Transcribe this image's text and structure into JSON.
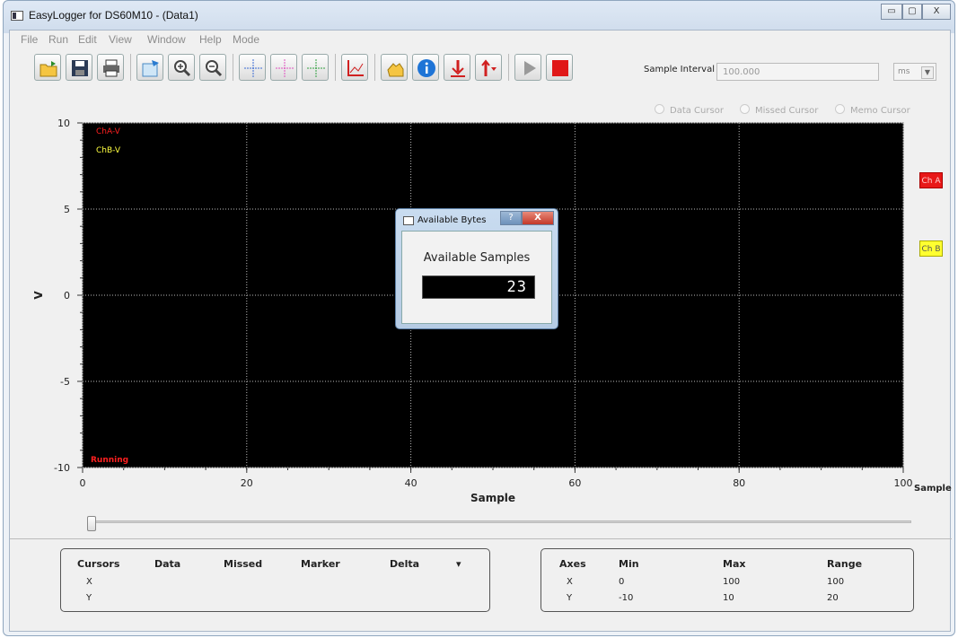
{
  "window": {
    "title": "EasyLogger for DS60M10 - (Data1)",
    "minimize": "▭",
    "maximize": "▢",
    "close": "X"
  },
  "menu": [
    "File",
    "Run",
    "Edit",
    "View",
    "Window",
    "Help",
    "Mode"
  ],
  "toolbar": {
    "buttons": [
      "open-icon",
      "save-icon",
      "print-icon",
      "export-icon",
      "zoom-in-icon",
      "zoom-out-icon",
      "cursor-blue-icon",
      "cursor-pink-icon",
      "cursor-green-icon",
      "axes-icon",
      "hand-icon",
      "info-icon",
      "down-arrow-icon",
      "up-arrow-icon",
      "play-icon",
      "stop-icon"
    ],
    "sample_interval_label": "Sample Interval",
    "sample_interval_value": "100.000",
    "unit_value": "ms",
    "unit_arrow": "▼"
  },
  "cursors_radio": [
    "Data Cursor",
    "Missed Cursor",
    "Memo Cursor"
  ],
  "colors": {
    "chA": "#ff2020",
    "chB": "#ffff40",
    "plot_bg": "#000000",
    "running": "#ff2020"
  },
  "chart_data": {
    "type": "line",
    "y_unit_label": "V",
    "ylabel": "V",
    "xlabel": "Sample",
    "x_unit_label": "Sample",
    "xlim": [
      0,
      100
    ],
    "ylim": [
      -10,
      10
    ],
    "x_ticks": [
      "0",
      "20",
      "40",
      "60",
      "80",
      "100"
    ],
    "y_ticks": [
      "10",
      "5",
      "0",
      "-5",
      "-10"
    ],
    "grid": true,
    "series": [
      {
        "name": "ChA-V",
        "values": []
      },
      {
        "name": "ChB-V",
        "values": []
      }
    ],
    "status_text": "Running"
  },
  "channel_buttons": {
    "a": "Ch A",
    "b": "Ch B"
  },
  "dialog": {
    "title": "Available Bytes",
    "help": "?",
    "close": "X",
    "label": "Available Samples",
    "value": "23"
  },
  "cursors_panel": {
    "headers": [
      "Cursors",
      "Data",
      "Missed",
      "Marker",
      "Delta"
    ],
    "dropdown": "▾",
    "rows": [
      "X",
      "Y"
    ]
  },
  "axes_panel": {
    "headers": [
      "Axes",
      "Min",
      "Max",
      "Range"
    ],
    "rows": [
      [
        "X",
        "0",
        "100",
        "100"
      ],
      [
        "Y",
        "-10",
        "10",
        "20"
      ]
    ]
  }
}
